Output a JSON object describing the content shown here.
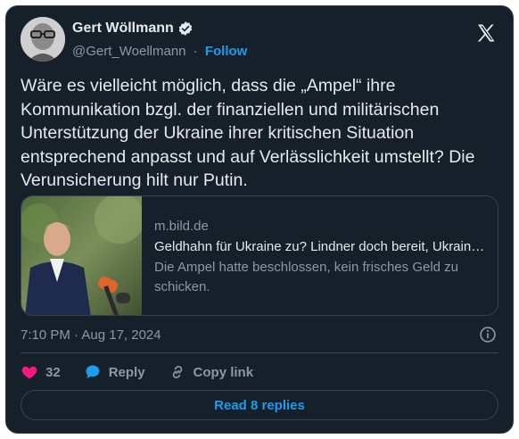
{
  "author": {
    "display_name": "Gert Wöllmann",
    "handle": "@Gert_Woellmann",
    "separator": "·",
    "follow_label": "Follow",
    "verified": true
  },
  "tweet": {
    "text": "Wäre es vielleicht möglich, dass die „Ampel“ ihre Kommunikation bzgl. der finanziellen und militärischen Unterstützung der Ukraine ihrer kritischen Situation entsprechend anpasst und auf Verlässlichkeit umstellt? Die Verunsicherung hilt nur Putin.",
    "timestamp": "7:10 PM · Aug 17, 2024"
  },
  "link_card": {
    "domain": "m.bild.de",
    "title": "Geldhahn für Ukraine zu? Lindner doch bereit, Ukraine-Hilfen aufzustocken",
    "description": "Die Ampel hatte beschlossen, kein frisches Geld zu schicken."
  },
  "actions": {
    "like_count": "32",
    "reply_label": "Reply",
    "copy_link_label": "Copy link"
  },
  "read_replies_label": "Read 8 replies",
  "colors": {
    "background": "#15202b",
    "accent": "#1d9bf0",
    "like": "#f91880",
    "text": "#e7e9ea",
    "muted": "#8b98a5"
  }
}
